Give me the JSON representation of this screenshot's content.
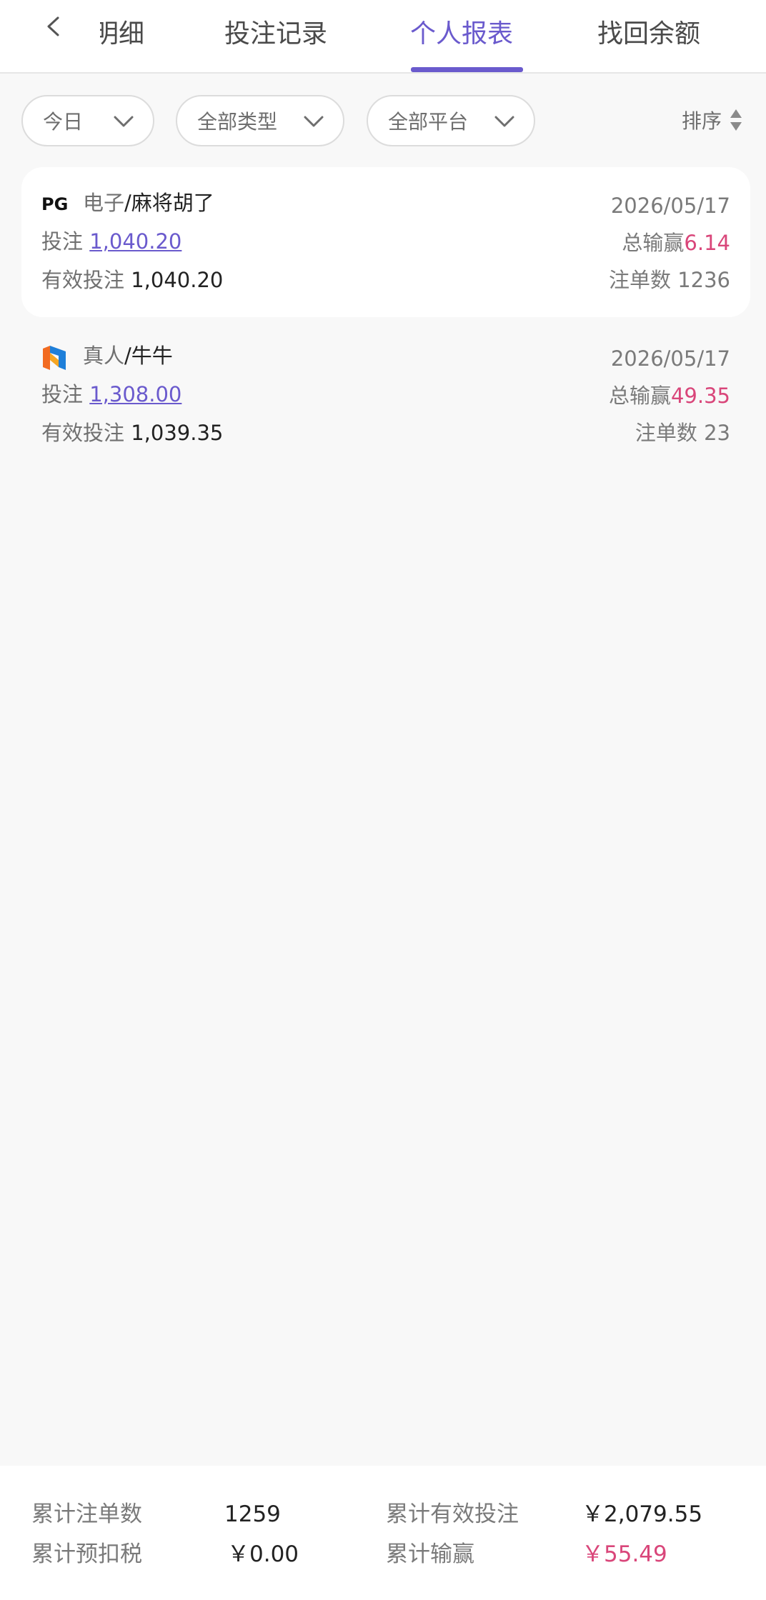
{
  "tabs": {
    "items": [
      {
        "label": "明细"
      },
      {
        "label": "投注记录"
      },
      {
        "label": "个人报表"
      },
      {
        "label": "找回余额"
      }
    ],
    "partial_first_label": "明细",
    "active_index": 2
  },
  "filters": {
    "date": "今日",
    "type": "全部类型",
    "platform": "全部平台",
    "sort": "排序"
  },
  "records": [
    {
      "logo_icon": "pg-logo-icon",
      "category": "电子",
      "separator": "/",
      "game": "麻将胡了",
      "bet_label": "投注",
      "bet_value": "1,040.20",
      "valid_bet_label": "有效投注",
      "valid_bet_value": "1,040.20",
      "date": "2026/05/17",
      "winloss_label": "总输赢",
      "winloss_value": "6.14",
      "orders_label": "注单数",
      "orders_value": "1236"
    },
    {
      "logo_icon": "live-provider-logo-icon",
      "category": "真人",
      "separator": "/",
      "game": "牛牛",
      "bet_label": "投注",
      "bet_value": "1,308.00",
      "valid_bet_label": "有效投注",
      "valid_bet_value": "1,039.35",
      "date": "2026/05/17",
      "winloss_label": "总输赢",
      "winloss_value": "49.35",
      "orders_label": "注单数",
      "orders_value": "23"
    }
  ],
  "summary": {
    "total_orders_label": "累计注单数",
    "total_orders_value": "1259",
    "total_valid_bet_label": "累计有效投注",
    "total_valid_bet_value": "￥2,079.55",
    "total_tax_label": "累计预扣税",
    "total_tax_value": "￥0.00",
    "total_winloss_label": "累计输赢",
    "total_winloss_value": "￥55.49"
  },
  "colors": {
    "accent": "#6a5acd",
    "winloss": "#d9467a",
    "background": "#f8f8f8"
  }
}
